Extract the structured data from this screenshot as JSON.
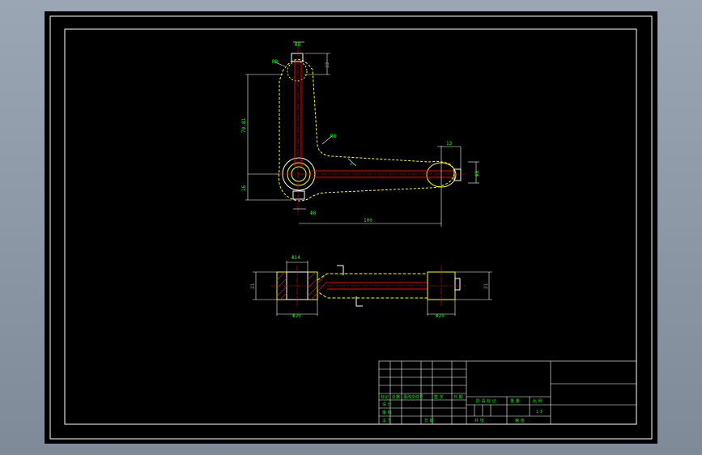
{
  "drawing": {
    "plan_view": {
      "dims": {
        "top_width": "Φ8",
        "top_radius": "R8",
        "top_offset": "13",
        "height": "70.81",
        "bend_radius": "R8",
        "bottom_offset": "16",
        "hub_bore": "Φ8",
        "length": "100",
        "arm_end_offset": "13",
        "arm_width": "5",
        "arm_end_bore": "Φ8"
      }
    },
    "section_view": {
      "dims": {
        "hub_top": "Φ14",
        "left_height": "21",
        "hub_dia": "Φ20",
        "end_dia": "Φ20",
        "right_height": "21"
      }
    }
  },
  "title_block": {
    "row_a": [
      "标记",
      "处数",
      "更改文件号",
      "签 字",
      "日 期"
    ],
    "row_b": [
      "设 计"
    ],
    "stage_label": "阶 段 标 记",
    "weight_label": "重 量",
    "scale_label": "比 例",
    "scale_value": "1:1",
    "review": "审 核",
    "process": "工 艺",
    "approve": "批 准",
    "sheet_total": "共   张",
    "sheet_no": "第   张",
    "date": "日 期"
  },
  "colors": {
    "frame": "#ffffff",
    "outline": "#ffff00",
    "center": "#ff0000",
    "dimension": "#00ff00",
    "hatch": "#ff0000"
  }
}
